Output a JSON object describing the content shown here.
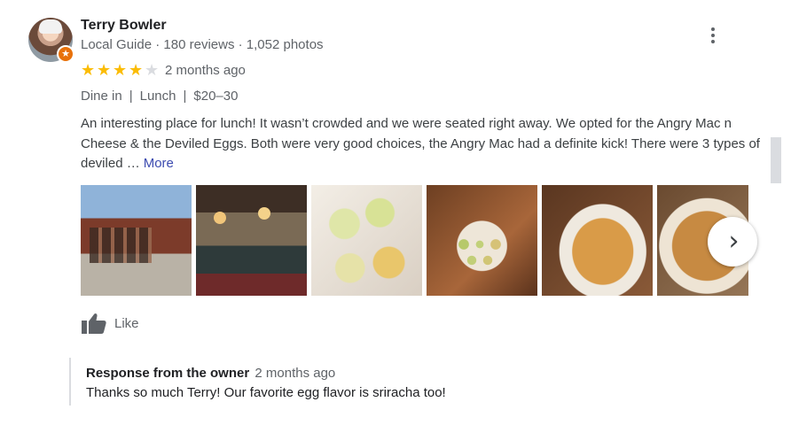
{
  "reviewer": {
    "name": "Terry Bowler",
    "badge": "Local Guide",
    "reviews": "180 reviews",
    "photos": "1,052 photos",
    "meta_sep": " · "
  },
  "rating": {
    "value": 4,
    "max": 5,
    "time_ago": "2 months ago"
  },
  "tags": [
    "Dine in",
    "Lunch",
    "$20–30"
  ],
  "tag_separator": "|",
  "review": {
    "text": "An interesting place for lunch!  It wasn’t crowded and we were seated right away.  We opted for the Angry Mac n Cheese & the Deviled Eggs.  Both were very good choices,  the Angry Mac had a definite kick!  There were 3 types of deviled …",
    "more_label": "More"
  },
  "photos": [
    "photo-storefront",
    "photo-interior",
    "photo-deviled-eggs-plate",
    "photo-deviled-eggs-tray",
    "photo-mac-n-cheese",
    "photo-mac-n-cheese-2"
  ],
  "actions": {
    "like_label": "Like"
  },
  "owner_response": {
    "title": "Response from the owner",
    "time_ago": "2 months ago",
    "text": "Thanks so much Terry! Our favorite egg flavor is sriracha too!"
  },
  "icons": {
    "more": "more-vert-icon",
    "next": "chevron-right-icon",
    "like": "thumb-up-icon",
    "badge": "local-guide-star-icon"
  },
  "colors": {
    "star_on": "#fbbc04",
    "star_off": "#dadce0",
    "badge": "#e8710a",
    "link": "#3c4bb0"
  }
}
